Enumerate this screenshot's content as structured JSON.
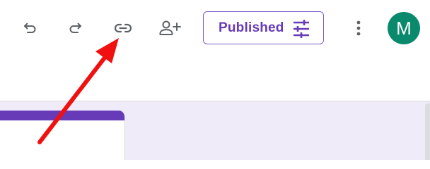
{
  "toolbar": {
    "undo_icon": "undo-icon",
    "redo_icon": "redo-icon",
    "link_icon": "link-icon",
    "add_collaborator_icon": "person-add-icon",
    "publish_button": {
      "label": "Published",
      "icon": "tune-icon"
    },
    "more_icon": "more-vert-icon",
    "avatar": {
      "initial": "M",
      "color": "#0a8a6d"
    }
  },
  "annotation": {
    "type": "arrow",
    "color": "#f01010",
    "points_to": "link-button"
  },
  "colors": {
    "accent": "#673ab7",
    "workspace_background": "#efebf8",
    "icon": "#5f6368"
  }
}
